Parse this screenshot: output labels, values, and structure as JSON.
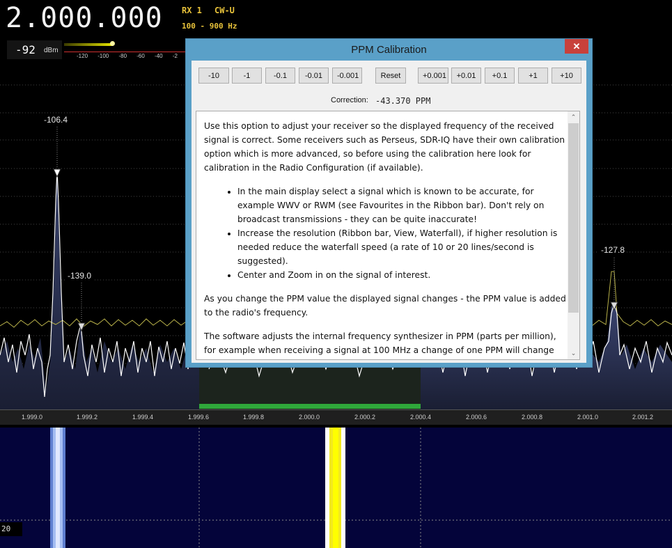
{
  "header": {
    "frequency": "2.000.000",
    "rx": "RX 1",
    "mode": "CW-U",
    "bandwidth": "100 - 900 Hz",
    "signal_level": "-92",
    "signal_unit": "dBm",
    "smeter_ticks": "-120 -100 -80 -60 -40 -2"
  },
  "spectrum": {
    "peak_labels": [
      "-106.4",
      "-139.0",
      "-127.8"
    ],
    "axis_labels": [
      "1.999.0",
      "1.999.2",
      "1.999.4",
      "1.999.6",
      "1.999.8",
      "2.000.0",
      "2.000.2",
      "2.000.4",
      "2.000.6",
      "2.000.8",
      "2.001.0",
      "2.001.2"
    ],
    "waterfall_label": "20"
  },
  "dialog": {
    "title": "PPM Calibration",
    "close_icon": "close-icon",
    "buttons": [
      "-10",
      "-1",
      "-0.1",
      "-0.01",
      "-0.001",
      "Reset",
      "+0.001",
      "+0.01",
      "+0.1",
      "+1",
      "+10"
    ],
    "correction_label": "Correction:",
    "correction_value": "-43.370 PPM",
    "help": {
      "p1": "Use this option to adjust your receiver so the displayed frequency of the received signal is correct. Some receivers such as Perseus, SDR-IQ have their own calibration option which is more advanced, so before using the calibration here look for calibration in the Radio Configuration (if available).",
      "bullet1": "In the main display select a signal which is known to be accurate, for example WWV or RWM (see Favourites in the Ribbon bar). Don't rely on broadcast transmissions - they can be quite inaccurate!",
      "bullet2": "Increase the resolution (Ribbon bar, View, Waterfall), if higher resolution is needed reduce the waterfall speed (a rate of 10 or 20 lines/second is suggested).",
      "bullet3": "Center and Zoom in on the signal of interest.",
      "p2": "As you change the PPM value the displayed signal changes - the PPM value is added to the radio's frequency.",
      "p3": "The software adjusts the internal frequency synthesizer in PPM (parts per million), for example when receiving a signal at 100 MHz a change of one PPM will change"
    }
  }
}
